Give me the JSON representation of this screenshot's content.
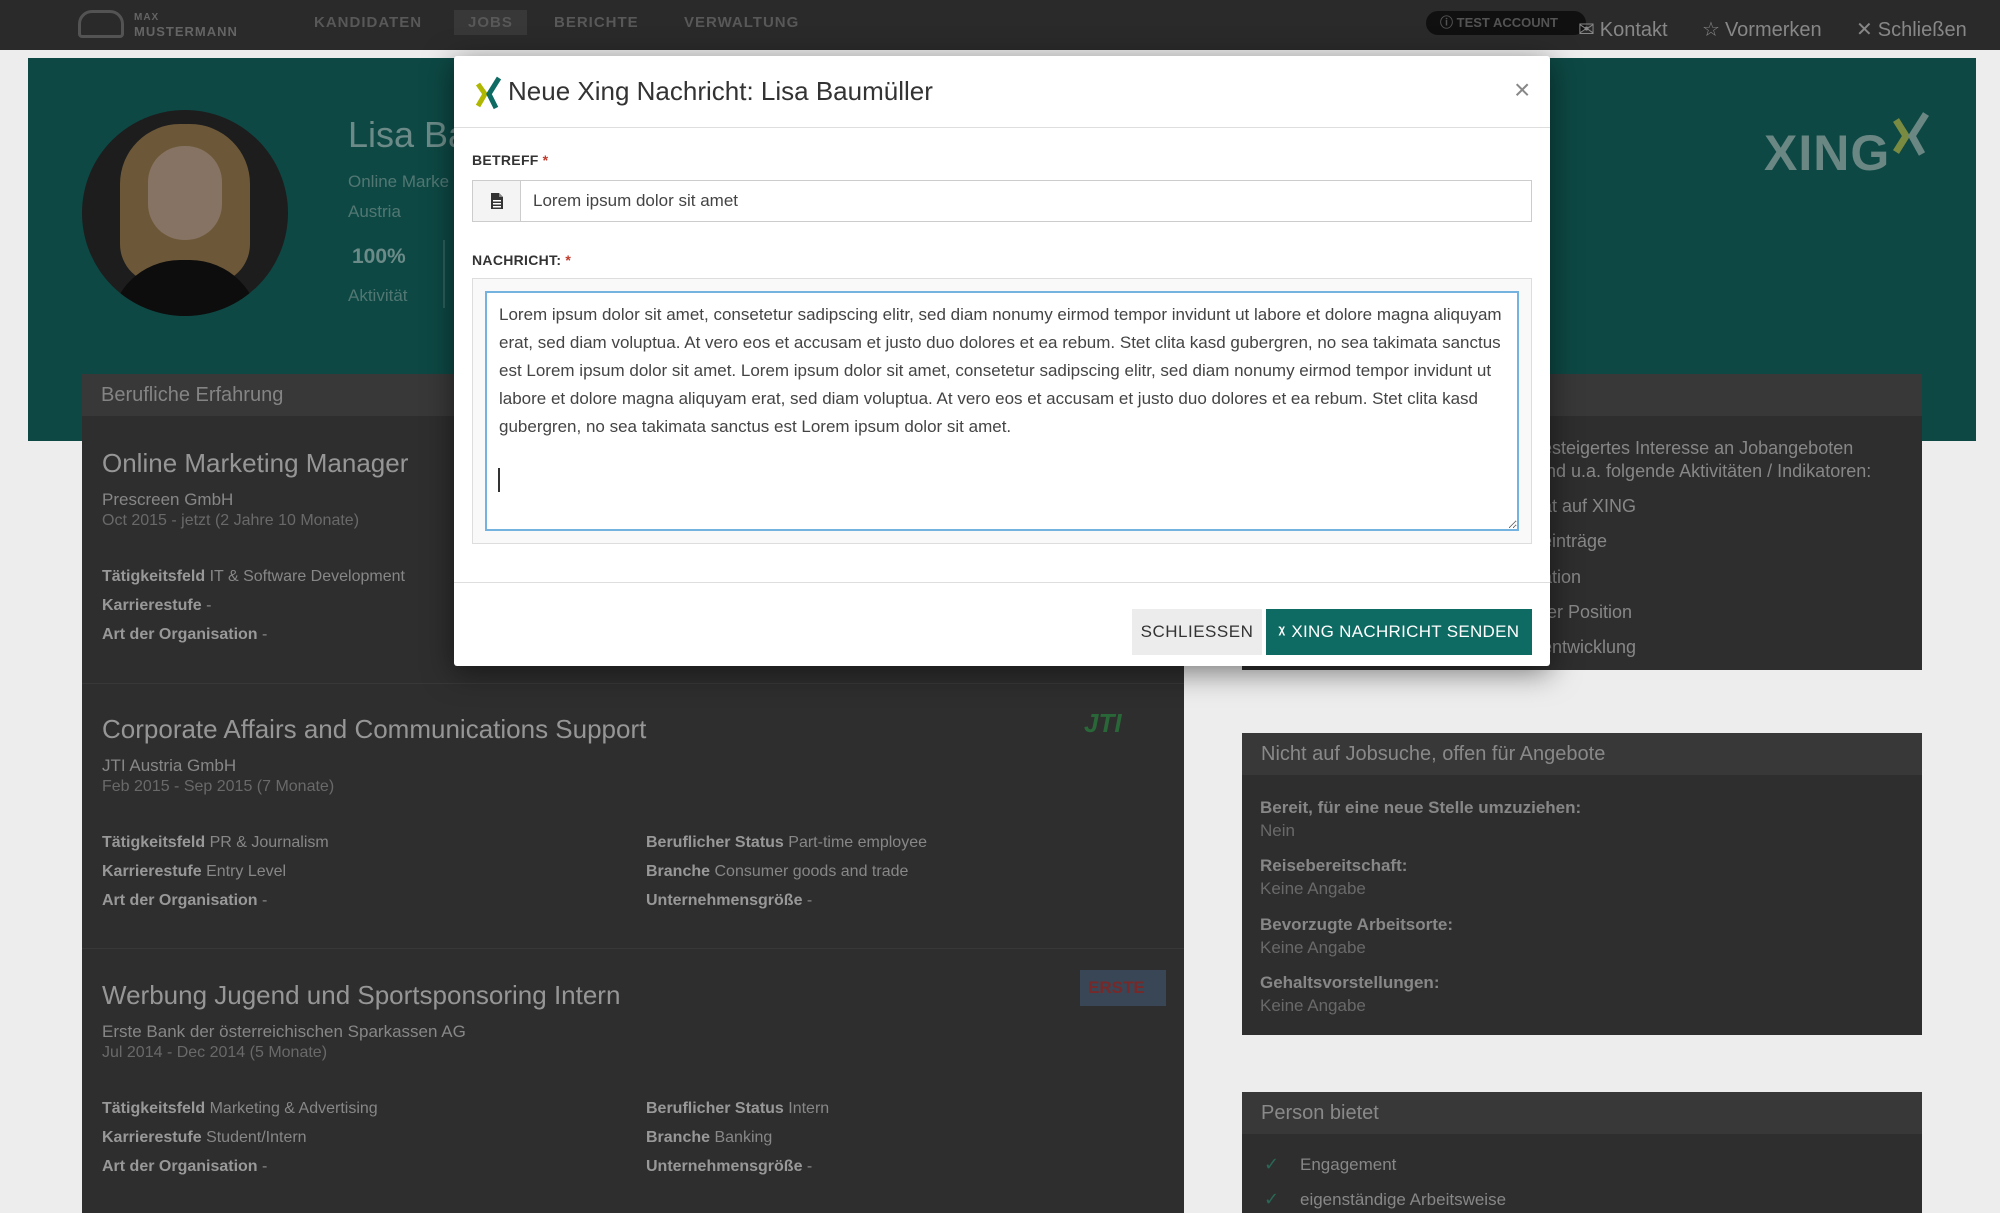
{
  "nav": {
    "brand_small": "MAX",
    "brand_big": "MUSTERMANN",
    "items": [
      "KANDIDATEN",
      "JOBS",
      "BERICHTE",
      "VERWALTUNG"
    ],
    "test_badge": "TEST ACCOUNT",
    "kontakt": "Kontakt",
    "vormerken": "Vormerken",
    "schliessen": "Schließen"
  },
  "profile": {
    "name_visible": "Lisa Ba",
    "title_visible": "Online Marke",
    "location": "Austria",
    "activity_pct": "100%",
    "activity_label": "Aktivität"
  },
  "experience": {
    "header": "Berufliche Erfahrung",
    "jobs": [
      {
        "title": "Online Marketing Manager",
        "company": "Prescreen GmbH",
        "dates": "Oct 2015 - jetzt (2 Jahre 10 Monate)",
        "taetigkeitsfeld_label": "Tätigkeitsfeld",
        "taetigkeitsfeld": "IT & Software Development",
        "karrierestufe_label": "Karrierestufe",
        "karrierestufe": "-",
        "art_label": "Art der Organisation",
        "art": "-"
      },
      {
        "title": "Corporate Affairs and Communications Support",
        "company": "JTI Austria GmbH",
        "dates": "Feb 2015 - Sep 2015 (7 Monate)",
        "taetigkeitsfeld": "PR & Journalism",
        "karrierestufe": "Entry Level",
        "art": "-",
        "status_label": "Beruflicher Status",
        "status": "Part-time employee",
        "branche_label": "Branche",
        "branche": "Consumer goods and trade",
        "groesse_label": "Unternehmensgröße",
        "groesse": "-",
        "logo": "JTI"
      },
      {
        "title": "Werbung Jugend und Sportsponsoring Intern",
        "company": "Erste Bank der österreichischen Sparkassen AG",
        "dates": "Jul 2014 - Dec 2014 (5 Monate)",
        "taetigkeitsfeld": "Marketing & Advertising",
        "karrierestufe": "Student/Intern",
        "art": "-",
        "status": "Intern",
        "branche": "Banking",
        "groesse": "-",
        "logo": "ERSTE"
      }
    ]
  },
  "activity_card": {
    "line1": "esteigertes Interesse an Jobangeboten",
    "line2": "ind u.a. folgende Aktivitäten / Indikatoren:",
    "items": [
      "ät auf XING",
      "einträge",
      "ation",
      "ter Position",
      "entwicklung"
    ]
  },
  "jobsearch_card": {
    "header": "Nicht auf Jobsuche, offen für Angebote",
    "fields": [
      {
        "label": "Bereit, für eine neue Stelle umzuziehen:",
        "value": "Nein"
      },
      {
        "label": "Reisebereitschaft:",
        "value": "Keine Angabe"
      },
      {
        "label": "Bevorzugte Arbeitsorte:",
        "value": "Keine Angabe"
      },
      {
        "label": "Gehaltsvorstellungen:",
        "value": "Keine Angabe"
      }
    ]
  },
  "offers_card": {
    "header": "Person bietet",
    "items": [
      "Engagement",
      "eigenständige Arbeitsweise"
    ]
  },
  "header_logo": "XING",
  "modal": {
    "title": "Neue Xing Nachricht: Lisa Baumüller",
    "subject_label": "BETREFF",
    "subject_value": "Lorem ipsum dolor sit amet",
    "message_label": "NACHRICHT:",
    "required_mark": "*",
    "message_value": "Lorem ipsum dolor sit amet, consetetur sadipscing elitr, sed diam nonumy eirmod tempor invidunt ut labore et dolore magna aliquyam erat, sed diam voluptua. At vero eos et accusam et justo duo dolores et ea rebum. Stet clita kasd gubergren, no sea takimata sanctus est Lorem ipsum dolor sit amet. Lorem ipsum dolor sit amet, consetetur sadipscing elitr, sed diam nonumy eirmod tempor invidunt ut labore et dolore magna aliquyam erat, sed diam voluptua. At vero eos et accusam et justo duo dolores et ea rebum. Stet clita kasd gubergren, no sea takimata sanctus est Lorem ipsum dolor sit amet.",
    "close_button": "SCHLIESSEN",
    "send_button": "XING NACHRICHT SENDEN"
  },
  "colors": {
    "accent": "#0e6b63",
    "hero": "#0e4a46",
    "focus": "#74b2e0",
    "required": "#c0392b"
  }
}
